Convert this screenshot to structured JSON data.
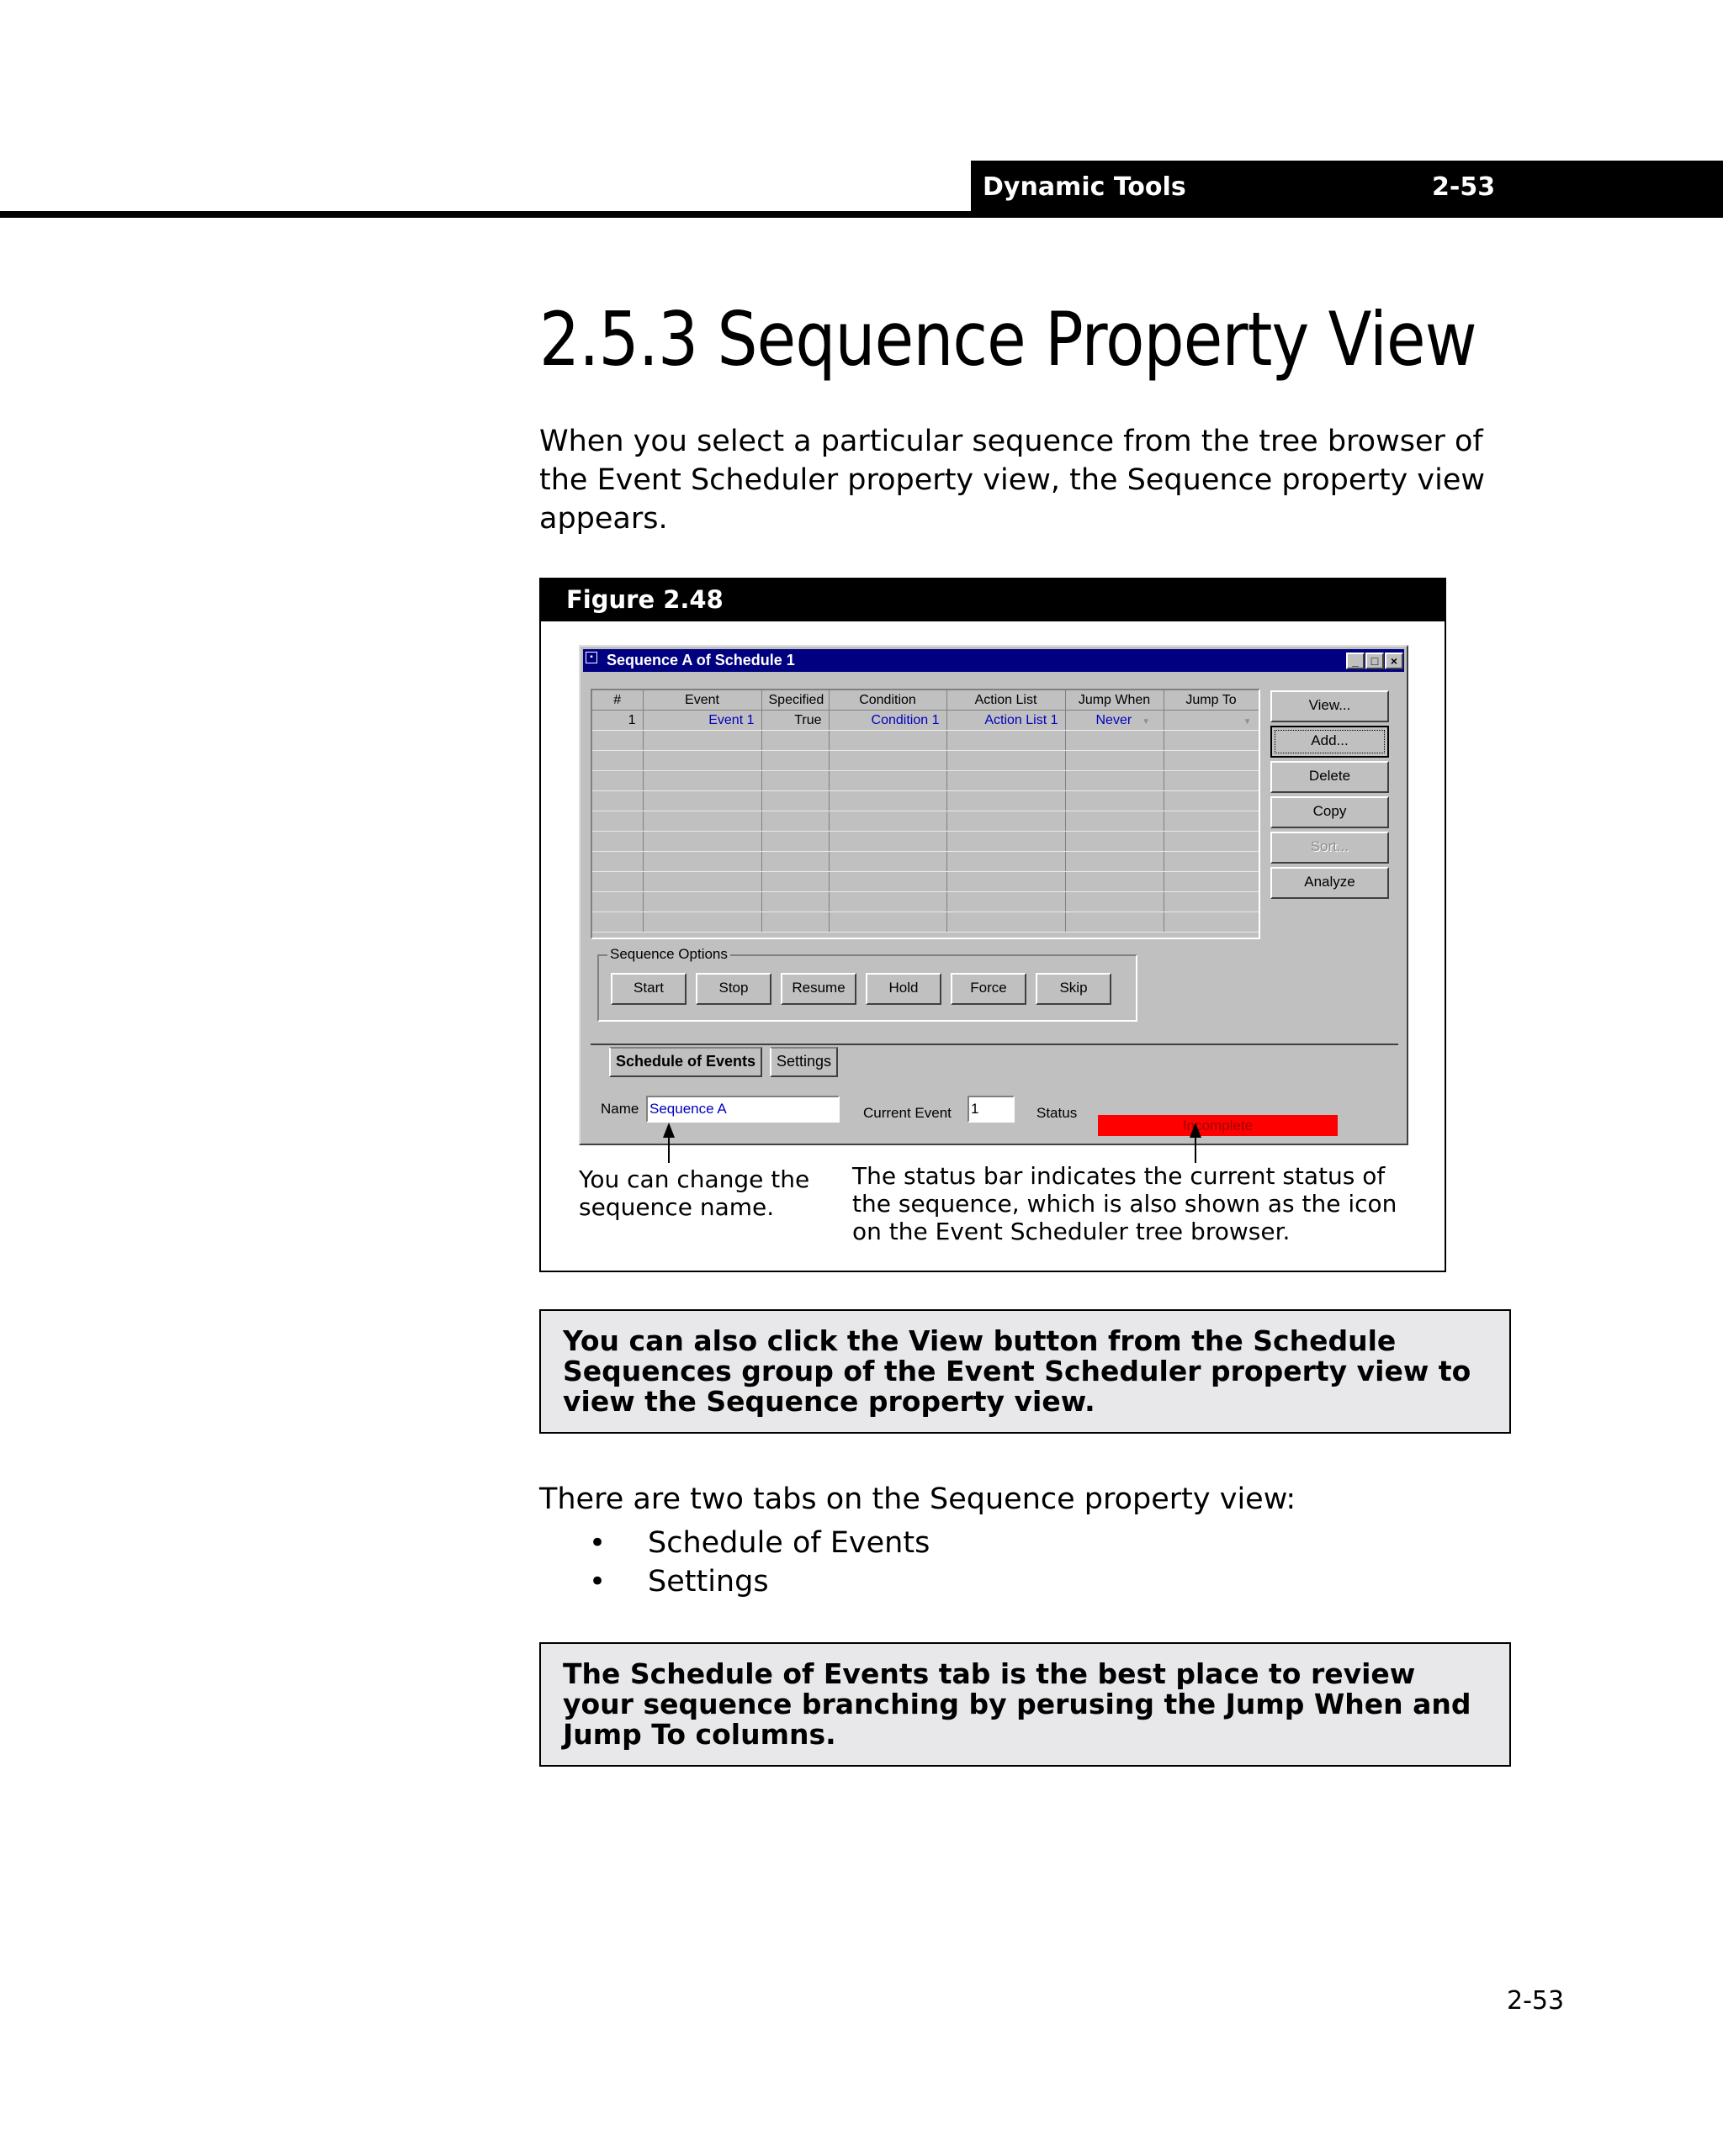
{
  "header": {
    "section": "Dynamic Tools",
    "page": "2-53"
  },
  "title": "2.5.3 Sequence Property View",
  "intro": "When you select a particular sequence from the tree browser of the Event Scheduler property view, the Sequence property view appears.",
  "figure": {
    "caption": "Figure 2.48",
    "window": {
      "title": "Sequence A of Schedule 1",
      "title_icon": "app-icon",
      "controls": {
        "minimize": "_",
        "maximize": "□",
        "close": "×"
      },
      "table": {
        "columns": [
          "#",
          "Event",
          "Specified",
          "Condition",
          "Action List",
          "Jump When",
          "Jump To"
        ],
        "rows": [
          {
            "num": "1",
            "event": "Event 1",
            "specified": "True",
            "condition": "Condition 1",
            "action_list": "Action List 1",
            "jump_when": "Never",
            "jump_to": ""
          }
        ]
      },
      "side_buttons": {
        "view": "View...",
        "add": "Add...",
        "delete": "Delete",
        "copy": "Copy",
        "sort": "Sort...",
        "analyze": "Analyze"
      },
      "sequence_options": {
        "legend": "Sequence Options",
        "buttons": {
          "start": "Start",
          "stop": "Stop",
          "resume": "Resume",
          "hold": "Hold",
          "force": "Force",
          "skip": "Skip"
        }
      },
      "tabs": {
        "schedule": "Schedule of Events",
        "settings": "Settings"
      },
      "name_label": "Name",
      "name_value": "Sequence A",
      "current_event_label": "Current Event",
      "current_event_value": "1",
      "status_label": "Status",
      "status_value": "Incomplete",
      "status_color": "#ff0000"
    },
    "callouts": {
      "name": "You can change the sequence name.",
      "status": "The status bar indicates the current status of the sequence, which is also shown as the icon on the Event Scheduler tree browser."
    }
  },
  "note1": "You can also click the View button from the Schedule Sequences group of the Event Scheduler property view to view the Sequence property view.",
  "tabs_intro": "There are two tabs on the Sequence property view:",
  "tab_list": [
    "Schedule of Events",
    "Settings"
  ],
  "note2": "The Schedule of Events tab is the best place to review your sequence branching by perusing the Jump When and Jump To columns.",
  "footer_page": "2-53"
}
